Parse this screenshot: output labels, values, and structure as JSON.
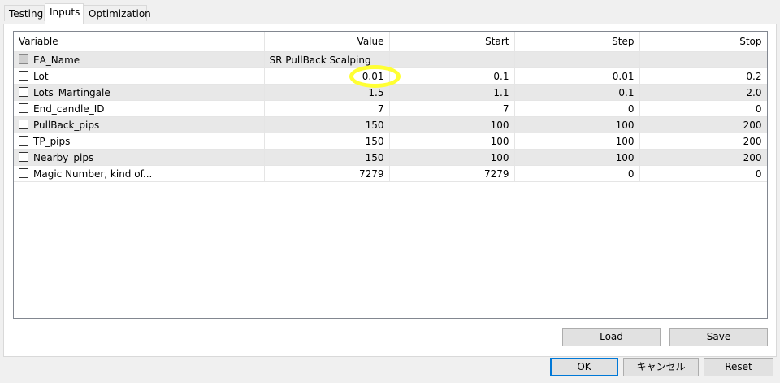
{
  "tabs": [
    {
      "label": "Testing"
    },
    {
      "label": "Inputs"
    },
    {
      "label": "Optimization"
    }
  ],
  "table": {
    "headers": [
      "Variable",
      "Value",
      "Start",
      "Step",
      "Stop"
    ],
    "rows": [
      {
        "variable": "EA_Name",
        "value": "SR PullBack Scalping",
        "start": "",
        "step": "",
        "stop": "",
        "checkbox_enabled": false
      },
      {
        "variable": "Lot",
        "value": "0.01",
        "start": "0.1",
        "step": "0.01",
        "stop": "0.2",
        "checkbox_enabled": true
      },
      {
        "variable": "Lots_Martingale",
        "value": "1.5",
        "start": "1.1",
        "step": "0.1",
        "stop": "2.0",
        "checkbox_enabled": true
      },
      {
        "variable": "End_candle_ID",
        "value": "7",
        "start": "7",
        "step": "0",
        "stop": "0",
        "checkbox_enabled": true
      },
      {
        "variable": "PullBack_pips",
        "value": "150",
        "start": "100",
        "step": "100",
        "stop": "200",
        "checkbox_enabled": true
      },
      {
        "variable": "TP_pips",
        "value": "150",
        "start": "100",
        "step": "100",
        "stop": "200",
        "checkbox_enabled": true
      },
      {
        "variable": "Nearby_pips",
        "value": "150",
        "start": "100",
        "step": "100",
        "stop": "200",
        "checkbox_enabled": true
      },
      {
        "variable": "Magic Number, kind of...",
        "value": "7279",
        "start": "7279",
        "step": "0",
        "stop": "0",
        "checkbox_enabled": true
      }
    ]
  },
  "panel_buttons": {
    "load": "Load",
    "save": "Save"
  },
  "dialog_buttons": {
    "ok": "OK",
    "cancel": "キャンセル",
    "reset": "Reset"
  },
  "colors": {
    "highlight": "#ffff33",
    "default_button_border": "#0078d7",
    "row_alt": "#e8e8e8"
  }
}
